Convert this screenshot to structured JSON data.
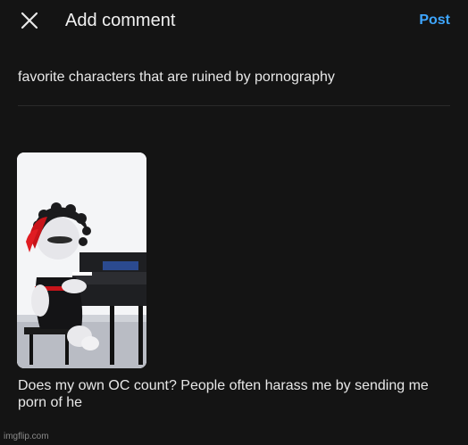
{
  "header": {
    "title": "Add comment",
    "post_label": "Post",
    "close_icon": "close-icon"
  },
  "prompt_text": "favorite characters that are ruined by pornography",
  "attachment": {
    "description_icon": "image-thumbnail"
  },
  "comment_text": "Does my own OC count? People often harass me by sending me porn of he",
  "watermark": "imgflip.com",
  "colors": {
    "background": "#141414",
    "accent": "#3ea6ff",
    "text": "#e8e8e8"
  }
}
